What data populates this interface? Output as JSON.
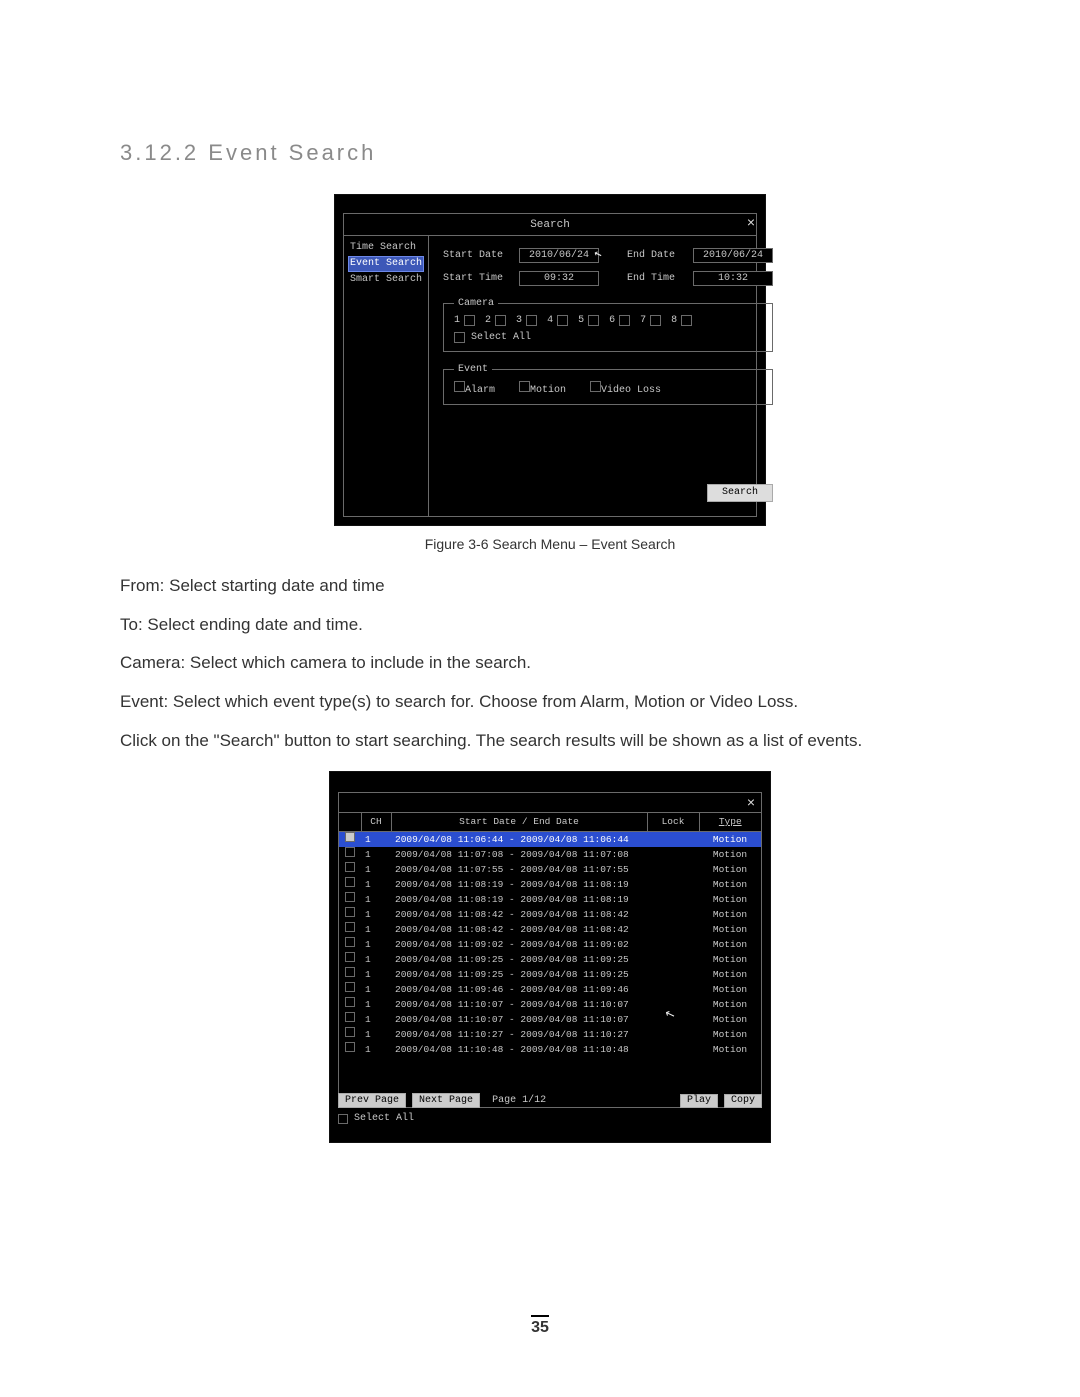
{
  "heading": {
    "number": "3.12.2",
    "title": "Event Search"
  },
  "figcaption1": "Figure 3-6 Search Menu – Event Search",
  "body": {
    "p1_label": "From:",
    "p1_text": " Select starting date and time",
    "p2_label": "To:",
    "p2_text": " Select ending date and time.",
    "p3_label": "Camera:",
    "p3_text": " Select which camera to include in the search.",
    "p4_label": "Event:",
    "p4_text": " Select which event type(s) to search for. Choose from Alarm, Motion or Video Loss.",
    "p5a": "Click on the \"",
    "p5_label": "Search",
    "p5b": "\" button to start searching. The search results will be shown as a list of events."
  },
  "page_number": "35",
  "dvr1": {
    "title": "Search",
    "close": "×",
    "side": {
      "items": [
        "Time Search",
        "Event Search",
        "Smart Search"
      ],
      "selected_index": 1
    },
    "labels": {
      "start_date": "Start Date",
      "end_date": "End Date",
      "start_time": "Start Time",
      "end_time": "End Time",
      "camera_legend": "Camera",
      "select_all": "Select All",
      "event_legend": "Event",
      "alarm": "Alarm",
      "motion": "Motion",
      "video_loss": "Video Loss",
      "search_btn": "Search"
    },
    "values": {
      "start_date": "2010/06/24",
      "end_date": "2010/06/24",
      "start_time": "09:32",
      "end_time": "10:32"
    },
    "cameras": [
      "1",
      "2",
      "3",
      "4",
      "5",
      "6",
      "7",
      "8"
    ]
  },
  "dvr2": {
    "close": "×",
    "columns": {
      "ch": "CH",
      "date": "Start Date / End Date",
      "lock": "Lock",
      "type": "Type"
    },
    "footer": {
      "prev": "Prev Page",
      "next": "Next Page",
      "page": "Page 1/12",
      "play": "Play",
      "copy": "Copy",
      "select_all": "Select All"
    },
    "rows": [
      {
        "selected": true,
        "ch": "1",
        "range": "2009/04/08 11:06:44 - 2009/04/08 11:06:44",
        "lock": "",
        "type": "Motion"
      },
      {
        "selected": false,
        "ch": "1",
        "range": "2009/04/08 11:07:08 - 2009/04/08 11:07:08",
        "lock": "",
        "type": "Motion"
      },
      {
        "selected": false,
        "ch": "1",
        "range": "2009/04/08 11:07:55 - 2009/04/08 11:07:55",
        "lock": "",
        "type": "Motion"
      },
      {
        "selected": false,
        "ch": "1",
        "range": "2009/04/08 11:08:19 - 2009/04/08 11:08:19",
        "lock": "",
        "type": "Motion"
      },
      {
        "selected": false,
        "ch": "1",
        "range": "2009/04/08 11:08:19 - 2009/04/08 11:08:19",
        "lock": "",
        "type": "Motion"
      },
      {
        "selected": false,
        "ch": "1",
        "range": "2009/04/08 11:08:42 - 2009/04/08 11:08:42",
        "lock": "",
        "type": "Motion"
      },
      {
        "selected": false,
        "ch": "1",
        "range": "2009/04/08 11:08:42 - 2009/04/08 11:08:42",
        "lock": "",
        "type": "Motion"
      },
      {
        "selected": false,
        "ch": "1",
        "range": "2009/04/08 11:09:02 - 2009/04/08 11:09:02",
        "lock": "",
        "type": "Motion"
      },
      {
        "selected": false,
        "ch": "1",
        "range": "2009/04/08 11:09:25 - 2009/04/08 11:09:25",
        "lock": "",
        "type": "Motion"
      },
      {
        "selected": false,
        "ch": "1",
        "range": "2009/04/08 11:09:25 - 2009/04/08 11:09:25",
        "lock": "",
        "type": "Motion"
      },
      {
        "selected": false,
        "ch": "1",
        "range": "2009/04/08 11:09:46 - 2009/04/08 11:09:46",
        "lock": "",
        "type": "Motion"
      },
      {
        "selected": false,
        "ch": "1",
        "range": "2009/04/08 11:10:07 - 2009/04/08 11:10:07",
        "lock": "",
        "type": "Motion"
      },
      {
        "selected": false,
        "ch": "1",
        "range": "2009/04/08 11:10:07 - 2009/04/08 11:10:07",
        "lock": "",
        "type": "Motion"
      },
      {
        "selected": false,
        "ch": "1",
        "range": "2009/04/08 11:10:27 - 2009/04/08 11:10:27",
        "lock": "",
        "type": "Motion"
      },
      {
        "selected": false,
        "ch": "1",
        "range": "2009/04/08 11:10:48 - 2009/04/08 11:10:48",
        "lock": "",
        "type": "Motion"
      }
    ]
  }
}
